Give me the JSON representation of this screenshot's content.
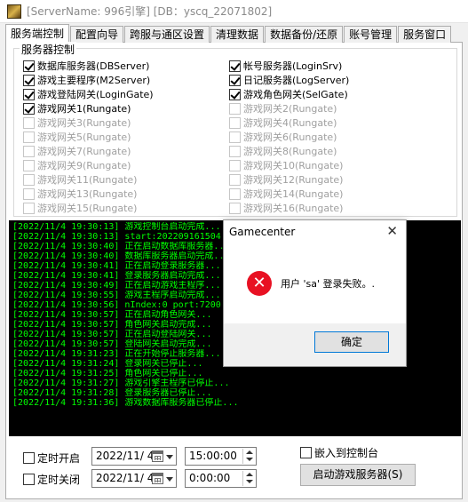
{
  "window": {
    "title": "[ServerName: 996引擎] [DB：yscq_22071802]"
  },
  "tabs": [
    "服务端控制",
    "配置向导",
    "跨服与通区设置",
    "清理数据",
    "数据备份/还原",
    "账号管理",
    "服务窗口"
  ],
  "server_control": {
    "group_title": "服务器控制",
    "left_items": [
      {
        "label": "数据库服务器(DBServer)",
        "checked": true,
        "enabled": true
      },
      {
        "label": "游戏主要程序(M2Server)",
        "checked": true,
        "enabled": true
      },
      {
        "label": "游戏登陆网关(LoginGate)",
        "checked": true,
        "enabled": true
      },
      {
        "label": "游戏网关1(Rungate)",
        "checked": true,
        "enabled": true
      },
      {
        "label": "游戏网关3(Rungate)",
        "checked": false,
        "enabled": false
      },
      {
        "label": "游戏网关5(Rungate)",
        "checked": false,
        "enabled": false
      },
      {
        "label": "游戏网关7(Rungate)",
        "checked": false,
        "enabled": false
      },
      {
        "label": "游戏网关9(Rungate)",
        "checked": false,
        "enabled": false
      },
      {
        "label": "游戏网关11(Rungate)",
        "checked": false,
        "enabled": false
      },
      {
        "label": "游戏网关13(Rungate)",
        "checked": false,
        "enabled": false
      },
      {
        "label": "游戏网关15(Rungate)",
        "checked": false,
        "enabled": false
      }
    ],
    "right_items": [
      {
        "label": "帐号服务器(LoginSrv)",
        "checked": true,
        "enabled": true
      },
      {
        "label": "日记服务器(LogServer)",
        "checked": true,
        "enabled": true
      },
      {
        "label": "游戏角色网关(SelGate)",
        "checked": true,
        "enabled": true
      },
      {
        "label": "游戏网关2(Rungate)",
        "checked": false,
        "enabled": false
      },
      {
        "label": "游戏网关4(Rungate)",
        "checked": false,
        "enabled": false
      },
      {
        "label": "游戏网关6(Rungate)",
        "checked": false,
        "enabled": false
      },
      {
        "label": "游戏网关8(Rungate)",
        "checked": false,
        "enabled": false
      },
      {
        "label": "游戏网关10(Rungate)",
        "checked": false,
        "enabled": false
      },
      {
        "label": "游戏网关12(Rungate)",
        "checked": false,
        "enabled": false
      },
      {
        "label": "游戏网关14(Rungate)",
        "checked": false,
        "enabled": false
      },
      {
        "label": "游戏网关16(Rungate)",
        "checked": false,
        "enabled": false
      }
    ]
  },
  "log_lines": [
    "[2022/11/4 19:30:13] 游戏控制台启动完成...",
    "[2022/11/4 19:30:13] start:202209161504",
    "[2022/11/4 19:30:40] 正在启动数据库服务器...",
    "[2022/11/4 19:30:40] 数据库服务器启动完成...",
    "[2022/11/4 19:30:41] 正在启动登录服务器...",
    "[2022/11/4 19:30:41] 登录服务器启动完成...",
    "[2022/11/4 19:30:49] 正在启动游戏主程序...",
    "[2022/11/4 19:30:55] 游戏主程序启动完成...",
    "[2022/11/4 19:30:56] nIndex:0 port:7200",
    "[2022/11/4 19:30:57] 正在启动角色网关...",
    "[2022/11/4 19:30:57] 角色网关启动完成...",
    "[2022/11/4 19:30:57] 正在启动登陆网关...",
    "[2022/11/4 19:30:57] 登陆网关启动完成...",
    "[2022/11/4 19:31:23] 正在开始停止服务器...",
    "[2022/11/4 19:31:24] 登录网关已停止...",
    "[2022/11/4 19:31:25] 角色网关已停止...",
    "[2022/11/4 19:31:27] 游戏引擎主程序已停止...",
    "[2022/11/4 19:31:28] 登录服务器已停止...",
    "[2022/11/4 19:31:36] 游戏数据库服务器已停止..."
  ],
  "schedule": {
    "start_label": "定时开启",
    "stop_label": "定时关闭",
    "start_date": "2022/11/ 4",
    "stop_date": "2022/11/ 4",
    "start_time": "15:00:00",
    "stop_time": "0:00:00"
  },
  "embed_label": "嵌入到控制台",
  "start_button_label": "启动游戏服务器(S)",
  "dialog": {
    "title": "Gamecenter",
    "close_glyph": "✕",
    "error_glyph": "✕",
    "message": "用户 'sa' 登录失败。.",
    "ok_label": "确定"
  },
  "colors": {
    "console_bg": "#000000",
    "console_text": "#00ff00",
    "error_red": "#e81123"
  },
  "icons": [
    "app-icon",
    "calendar-icon",
    "dropdown-arrow-icon",
    "spinner-icon",
    "error-icon",
    "close-icon"
  ]
}
